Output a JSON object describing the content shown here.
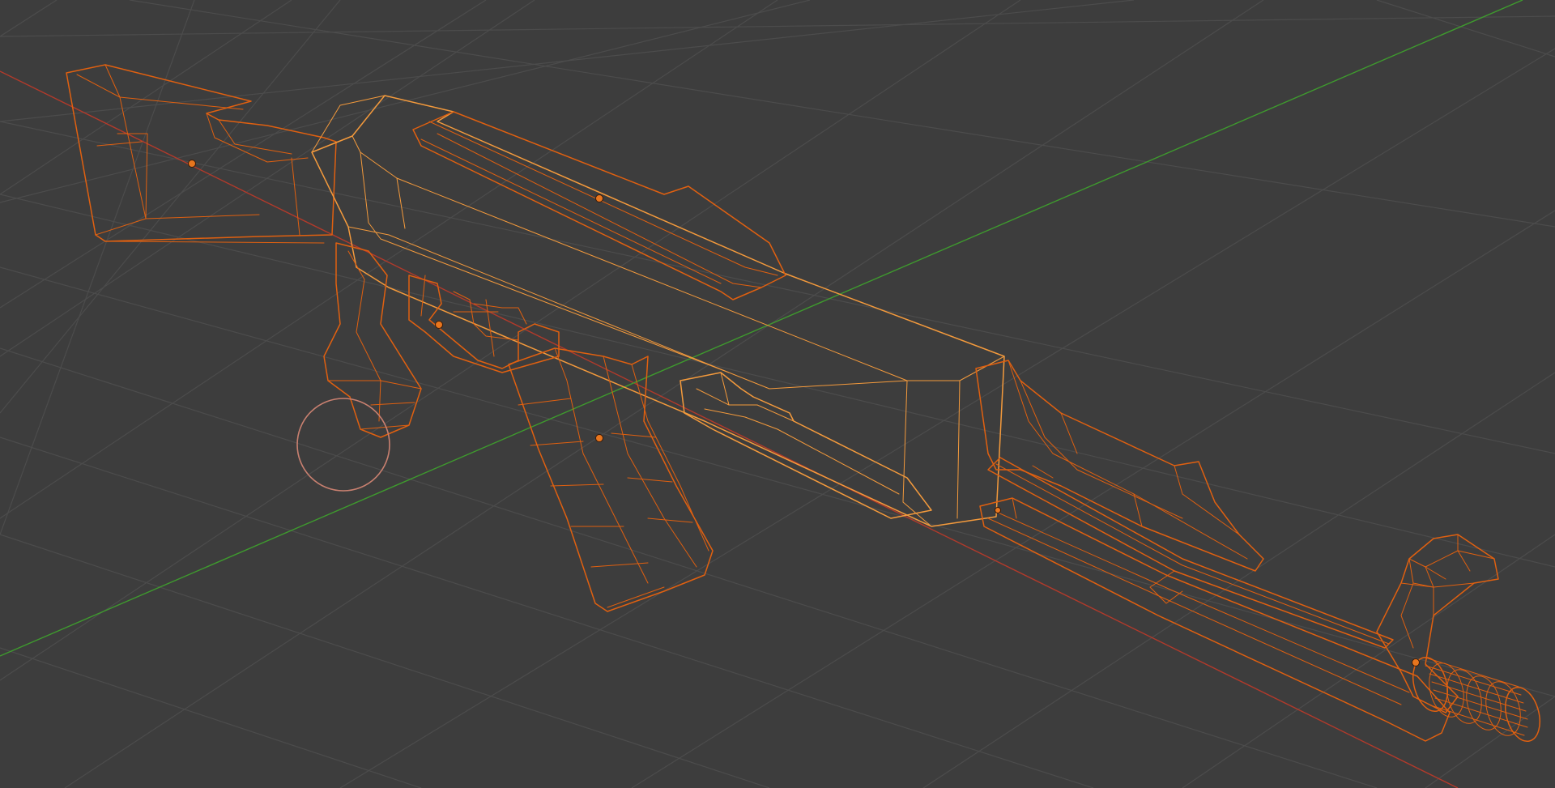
{
  "viewport": {
    "mode": "wireframe",
    "object": "assault-rifle-model",
    "object_selected": true,
    "axes": {
      "x_axis_color": "#b23a2b",
      "y_axis_color": "#3e9a2e"
    },
    "colors": {
      "background": "#3d3d3d",
      "grid_line": "#4c4c4c",
      "selection_wire_active": "#f49a3c",
      "selection_wire": "#e06010",
      "object_origin": "#e8761e",
      "cursor_3d": "#c98070"
    },
    "parts": [
      "stock",
      "receiver",
      "top-cover",
      "pistol-grip",
      "trigger-guard",
      "magazine",
      "handguard",
      "gas-tube",
      "barrel",
      "front-sight",
      "muzzle-brake"
    ],
    "origins_visible": 6
  }
}
